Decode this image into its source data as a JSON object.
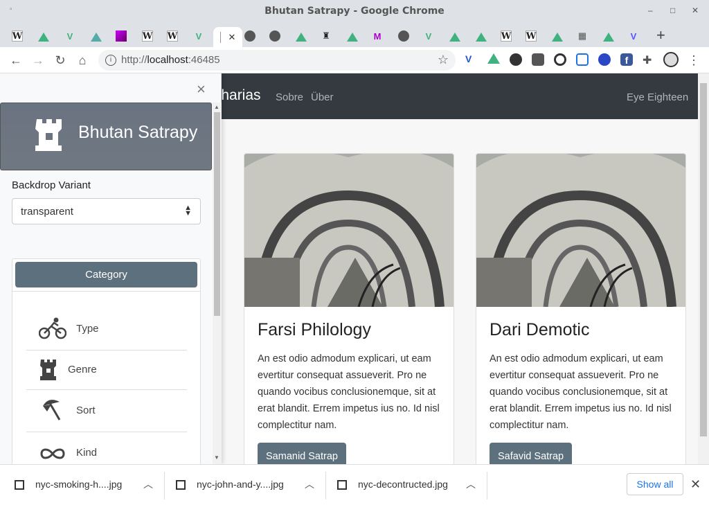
{
  "window": {
    "title": "Bhutan Satrapy - Google Chrome",
    "minimize": "–",
    "maximize": "□",
    "close": "✕"
  },
  "tabs": [
    {
      "icon": "wikipedia-icon"
    },
    {
      "icon": "vue-triangle-icon"
    },
    {
      "icon": "vue-v-icon"
    },
    {
      "icon": "vue-outline-icon"
    },
    {
      "icon": "magenta-square-icon"
    },
    {
      "icon": "wikipedia-icon"
    },
    {
      "icon": "wikipedia-icon"
    },
    {
      "icon": "vue-v-icon"
    },
    {
      "icon": "active-tab"
    },
    {
      "icon": "globe-icon"
    },
    {
      "icon": "globe-icon"
    },
    {
      "icon": "vue-triangle-icon"
    },
    {
      "icon": "ghost-icon"
    },
    {
      "icon": "vue-triangle-icon"
    },
    {
      "icon": "m-logo-icon"
    },
    {
      "icon": "globe-icon"
    },
    {
      "icon": "vue-v-icon"
    },
    {
      "icon": "vue-triangle-icon"
    },
    {
      "icon": "vue-triangle-icon"
    },
    {
      "icon": "wikipedia-icon"
    },
    {
      "icon": "wikipedia-icon"
    },
    {
      "icon": "vue-triangle-icon"
    },
    {
      "icon": "grid-icon"
    },
    {
      "icon": "vue-triangle-icon"
    },
    {
      "icon": "shield-v-icon"
    }
  ],
  "active_tab_close": "✕",
  "new_tab": "+",
  "toolbar": {
    "url_prefix": "http://",
    "url_host": "localhost",
    "url_port": ":46485",
    "menu": "⋮"
  },
  "navbar": {
    "brand": "ilharias",
    "links": [
      "Sobre",
      "Über"
    ],
    "right_link": "Eye Eighteen"
  },
  "cards": [
    {
      "title": "Farsi Philology",
      "text": "An est odio admodum explicari, ut eam evertitur consequat assueverit. Pro ne quando vocibus conclusionemque, sit at erat blandit. Errem impetus ius no. Id nisl complectitur nam.",
      "button": "Samanid Satrap"
    },
    {
      "title": "Dari Demotic",
      "text": "An est odio admodum explicari, ut eam evertitur consequat assueverit. Pro ne quando vocibus conclusionemque, sit at erat blandit. Errem impetus ius no. Id nisl complectitur nam.",
      "button": "Safavid Satrap"
    }
  ],
  "sidebar": {
    "close": "×",
    "title": "Bhutan Satrapy",
    "backdrop_label": "Backdrop Variant",
    "backdrop_value": "transparent",
    "category_button": "Category",
    "items": [
      {
        "label": "Type",
        "icon": "bicycle-icon"
      },
      {
        "label": "Genre",
        "icon": "castle-icon"
      },
      {
        "label": "Sort",
        "icon": "umbrella-beach-icon"
      },
      {
        "label": "Kind",
        "icon": "infinity-icon"
      }
    ]
  },
  "downloads": {
    "files": [
      "nyc-smoking-h....jpg",
      "nyc-john-and-y....jpg",
      "nyc-decontructed.jpg"
    ],
    "show_all": "Show all",
    "close": "✕"
  }
}
